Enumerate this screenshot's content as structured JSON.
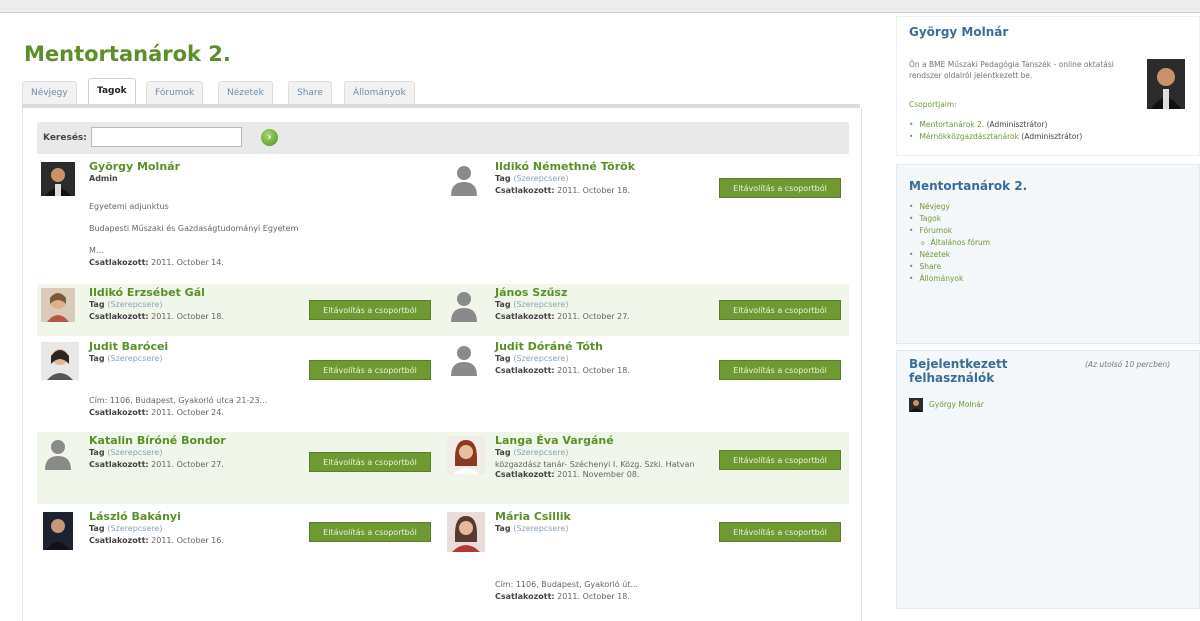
{
  "group": {
    "title": "Mentortanárok 2.",
    "tabs": [
      "Névjegy",
      "Tagok",
      "Fórumok",
      "Nézetek",
      "Share",
      "Állományok"
    ],
    "active_tab": "Tagok"
  },
  "search": {
    "label": "Keresés:",
    "value": ""
  },
  "remove_label": "Eltávolítás a csoportból",
  "members": [
    {
      "name": "György Molnár",
      "role": "Admin",
      "extra1": "Egyetemi adjunktus",
      "extra2": "Budapesti Műszaki és Gazdaságtudományi Egyetem",
      "extra3": "M...",
      "joined_label": "Csatlakozott:",
      "joined": "2011. October 14."
    },
    {
      "name": "Ildikó Némethné Török",
      "role": "Tag",
      "role_link": "(Szerepcsere)",
      "joined_label": "Csatlakozott:",
      "joined": "2011. October 18."
    },
    {
      "name": "Ildikó Erzsébet Gál",
      "role": "Tag",
      "role_link": "(Szerepcsere)",
      "joined_label": "Csatlakozott:",
      "joined": "2011. October 18."
    },
    {
      "name": "János Szűsz",
      "role": "Tag",
      "role_link": "(Szerepcsere)",
      "joined_label": "Csatlakozott:",
      "joined": "2011. October 27."
    },
    {
      "name": "Judit Barócei",
      "role": "Tag",
      "role_link": "(Szerepcsere)",
      "extra1": "Cím: 1106, Budapest, Gyakorló utca 21-23...",
      "joined_label": "Csatlakozott:",
      "joined": "2011. October 24."
    },
    {
      "name": "Judit Dóráné Tóth",
      "role": "Tag",
      "role_link": "(Szerepcsere)",
      "joined_label": "Csatlakozott:",
      "joined": "2011. October 18."
    },
    {
      "name": "Katalin Bíróné Bondor",
      "role": "Tag",
      "role_link": "(Szerepcsere)",
      "joined_label": "Csatlakozott:",
      "joined": "2011. October 27."
    },
    {
      "name": "Langa Éva Vargáné",
      "role": "Tag",
      "role_link": "(Szerepcsere)",
      "extra1": "közgazdász tanár- Széchenyi I. Közg. Szki. Hatvan",
      "joined_label": "Csatlakozott:",
      "joined": "2011. November 08."
    },
    {
      "name": "László Bakányi",
      "role": "Tag",
      "role_link": "(Szerepcsere)",
      "joined_label": "Csatlakozott:",
      "joined": "2011. October 16."
    },
    {
      "name": "Mária Csillik",
      "role": "Tag",
      "role_link": "(Szerepcsere)",
      "extra1": "Cím: 1106, Budapest, Gyakorló út...",
      "joined_label": "Csatlakozott:",
      "joined": "2011. October 18."
    }
  ],
  "sidebar": {
    "user": {
      "name": "György Molnár",
      "intro": "Ön a BME Műszaki Pedagógia Tanszék - online oktatási rendszer oldalról jelentkezett be.",
      "groups_label": "Csoportjaim:",
      "groups": [
        {
          "name": "Mentortanárok 2.",
          "role": "(Adminisztrátor)"
        },
        {
          "name": "Mérnökközgazdásztanárok",
          "role": "(Adminisztrátor)"
        }
      ]
    },
    "menu": {
      "title": "Mentortanárok 2.",
      "items": [
        "Névjegy",
        "Tagok",
        "Fórumok",
        "Általános fórum",
        "Nézetek",
        "Share",
        "Állományok"
      ]
    },
    "online": {
      "title": "Bejelentkezett felhasználók",
      "note": "(Az utolsó 10 percben)",
      "users": [
        "György Molnár"
      ]
    }
  },
  "colors": {
    "accent_green": "#5a8f2a",
    "button_green": "#6f9a33",
    "sidebar_title": "#3b6c9a"
  }
}
